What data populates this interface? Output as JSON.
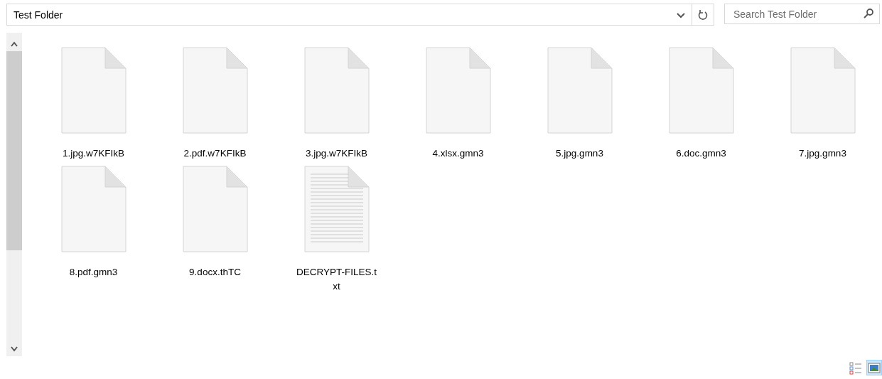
{
  "address_bar": {
    "path": "Test Folder"
  },
  "search": {
    "placeholder": "Search Test Folder"
  },
  "files": [
    {
      "name": "1.jpg.w7KFIkB",
      "kind": "blank"
    },
    {
      "name": "2.pdf.w7KFIkB",
      "kind": "blank"
    },
    {
      "name": "3.jpg.w7KFIkB",
      "kind": "blank"
    },
    {
      "name": "4.xlsx.gmn3",
      "kind": "blank"
    },
    {
      "name": "5.jpg.gmn3",
      "kind": "blank"
    },
    {
      "name": "6.doc.gmn3",
      "kind": "blank"
    },
    {
      "name": "7.jpg.gmn3",
      "kind": "blank"
    },
    {
      "name": "8.pdf.gmn3",
      "kind": "blank"
    },
    {
      "name": "9.docx.thTC",
      "kind": "blank"
    },
    {
      "name": "DECRYPT-FILES.txt",
      "kind": "text"
    }
  ],
  "view_buttons": [
    {
      "kind": "details",
      "selected": false
    },
    {
      "kind": "large-icons",
      "selected": true
    }
  ]
}
